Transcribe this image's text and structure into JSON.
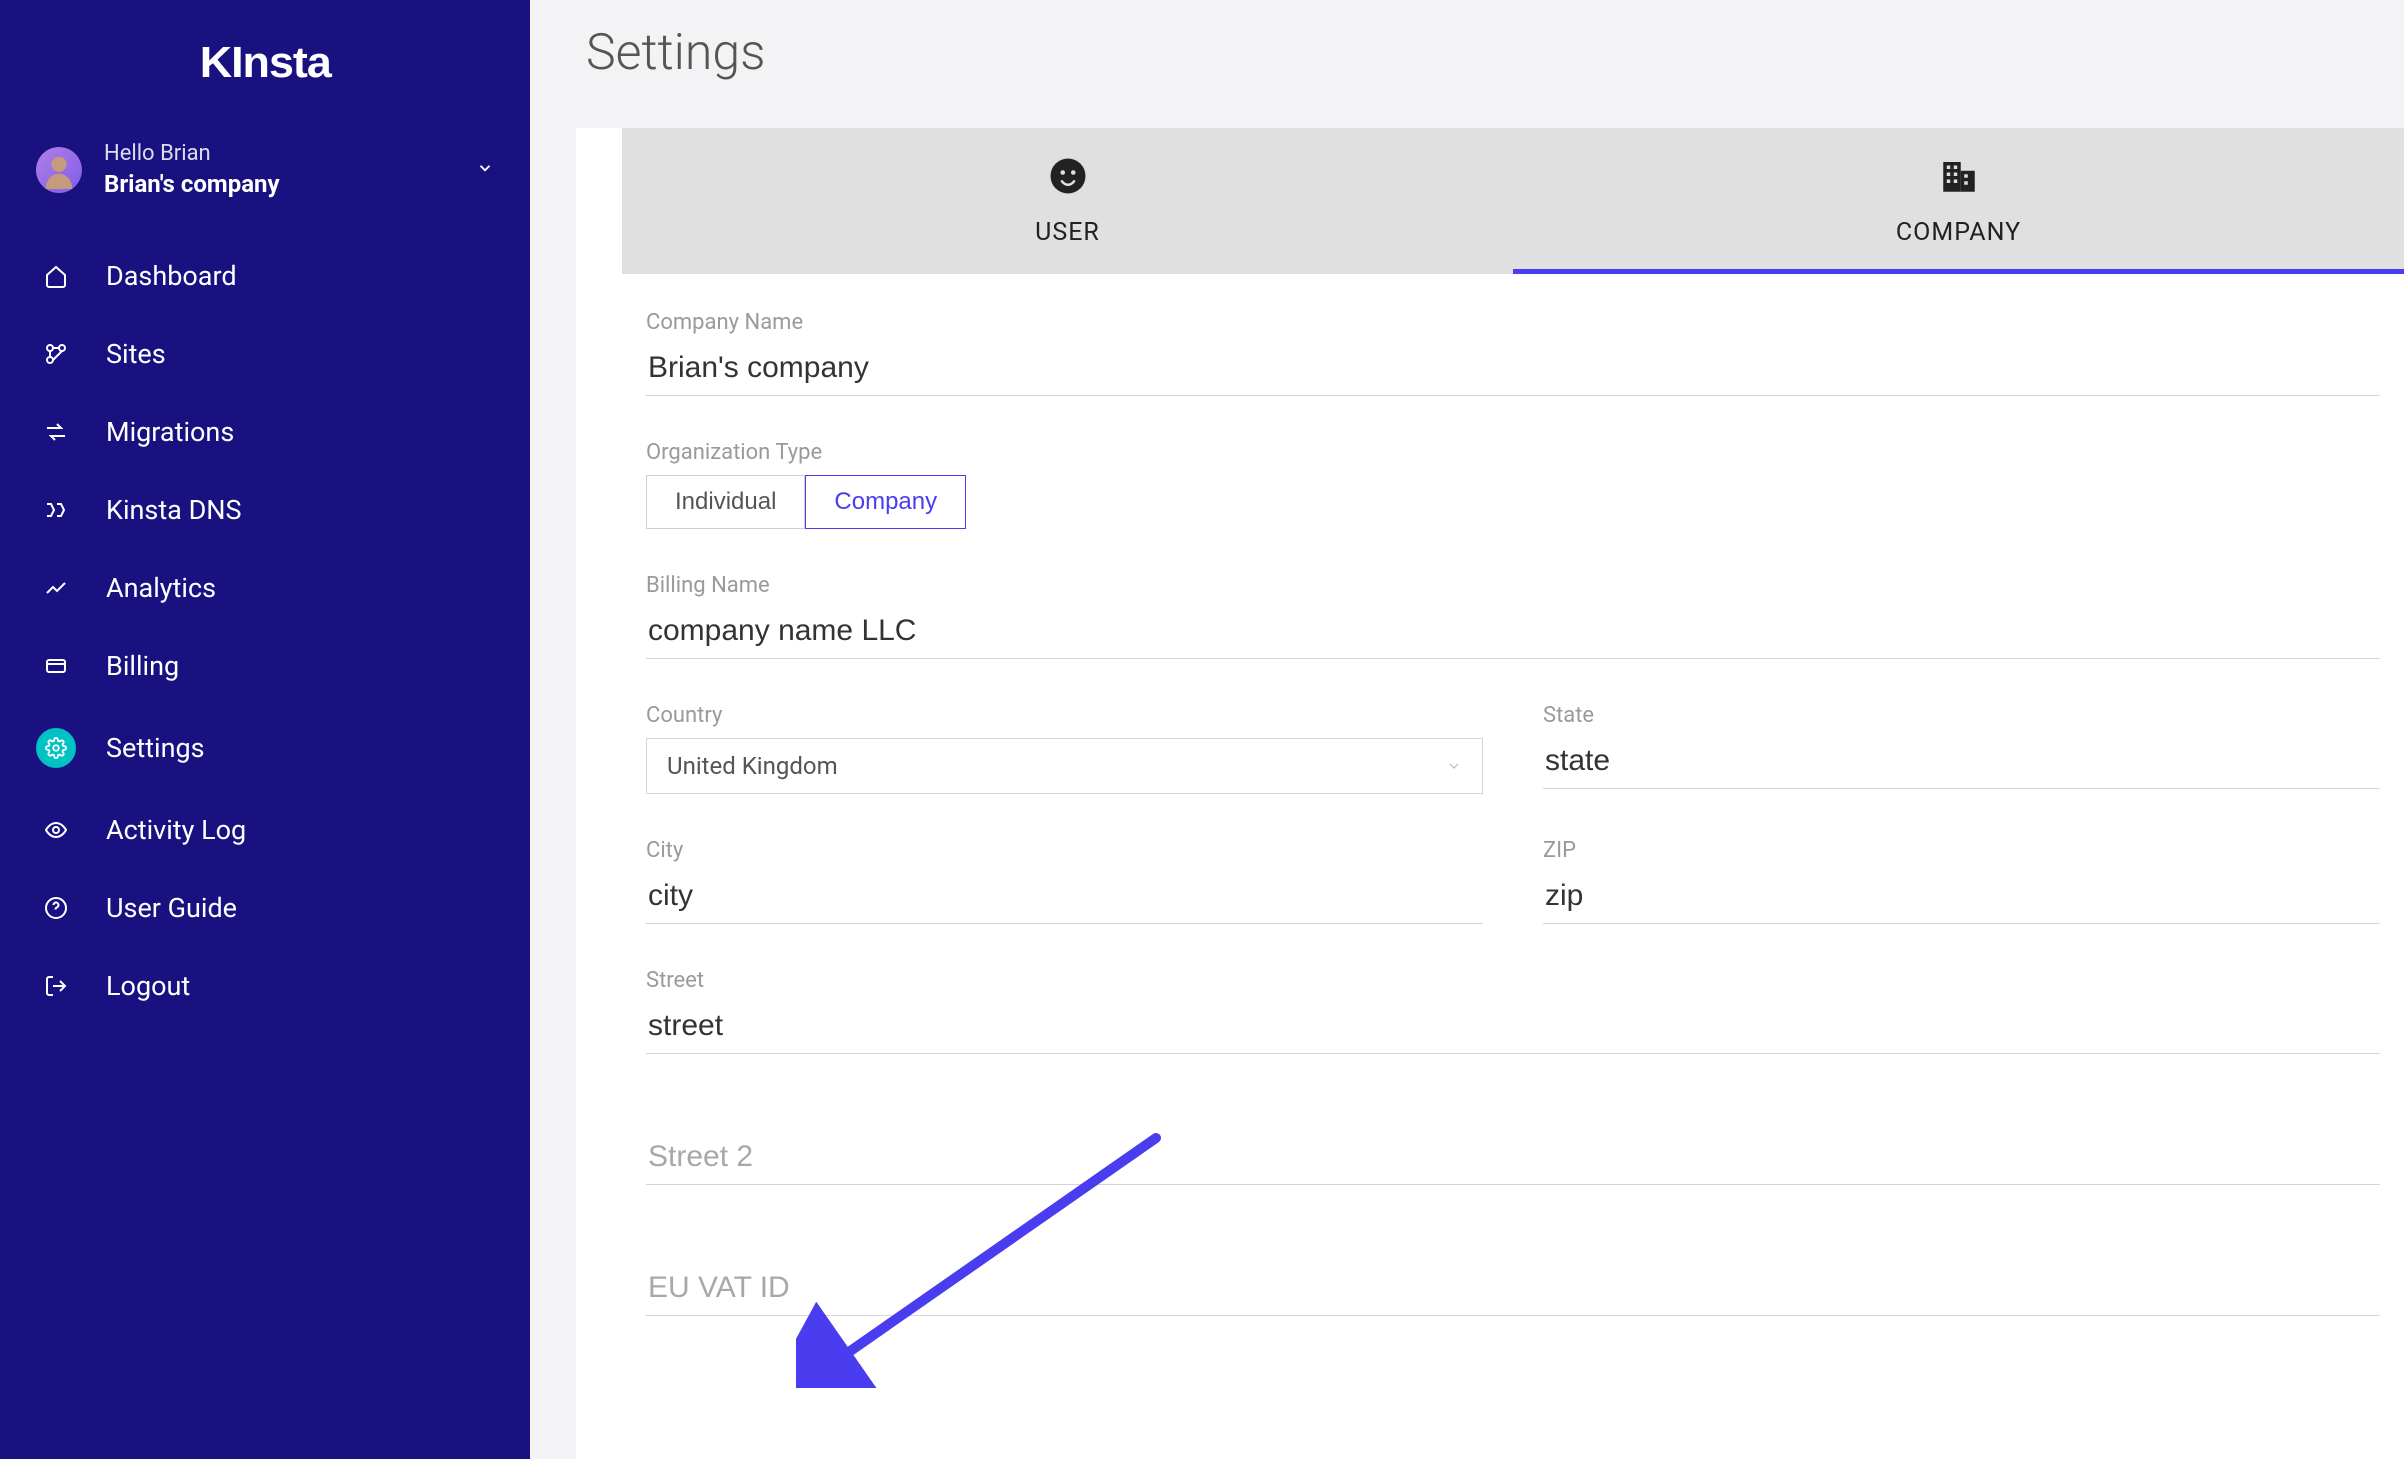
{
  "brand": "KInsta",
  "user": {
    "hello": "Hello Brian",
    "company": "Brian's company"
  },
  "nav": {
    "dashboard": "Dashboard",
    "sites": "Sites",
    "migrations": "Migrations",
    "dns": "Kinsta DNS",
    "analytics": "Analytics",
    "billing": "Billing",
    "settings": "Settings",
    "activity": "Activity Log",
    "guide": "User Guide",
    "logout": "Logout"
  },
  "page": {
    "title": "Settings"
  },
  "tabs": {
    "user": "USER",
    "company": "COMPANY"
  },
  "form": {
    "company_name_label": "Company Name",
    "company_name_value": "Brian's company",
    "org_type_label": "Organization Type",
    "org_individual": "Individual",
    "org_company": "Company",
    "billing_name_label": "Billing Name",
    "billing_name_value": "company name LLC",
    "country_label": "Country",
    "country_value": "United Kingdom",
    "state_label": "State",
    "state_value": "state",
    "city_label": "City",
    "city_value": "city",
    "zip_label": "ZIP",
    "zip_value": "zip",
    "street_label": "Street",
    "street_value": "street",
    "street2_placeholder": "Street 2",
    "vat_placeholder": "EU VAT ID"
  }
}
